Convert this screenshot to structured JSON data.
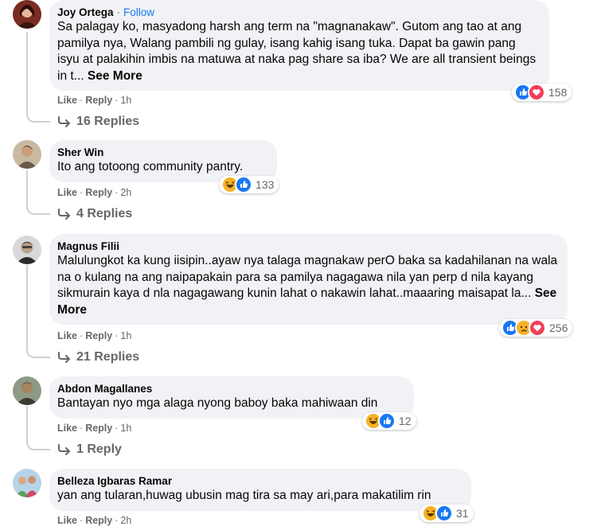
{
  "comments": [
    {
      "author": "Joy Ortega",
      "follow": "Follow",
      "text": "Sa palagay ko, masyadong harsh ang term na \"magnanakaw\". Gutom ang tao at ang pamilya nya, Walang pambili ng gulay, isang kahig isang tuka. Dapat ba gawin pang isyu at palakihin imbis na matuwa at naka pag share sa iba? We are all transient beings in t...",
      "see_more": "See More",
      "like": "Like",
      "reply": "Reply",
      "time": "1h",
      "reactions": [
        "like",
        "love"
      ],
      "reaction_count": "158",
      "replies_label": "16 Replies"
    },
    {
      "author": "Sher Win",
      "text": "Ito ang totoong community pantry.",
      "like": "Like",
      "reply": "Reply",
      "time": "2h",
      "reactions": [
        "haha",
        "like"
      ],
      "reaction_count": "133",
      "replies_label": "4 Replies"
    },
    {
      "author": "Magnus Filii",
      "text": "Malulungkot ka kung iisipin..ayaw nya talaga magnakaw perO baka sa kadahilanan na wala na o kulang na ang naipapakain para sa pamilya nagagawa nila yan perp d nila kayang sikmurain kaya d nla nagagawang kunin lahat o nakawin lahat..maaaring maisapat la...",
      "see_more": "See More",
      "like": "Like",
      "reply": "Reply",
      "time": "1h",
      "reactions": [
        "like",
        "sad",
        "love"
      ],
      "reaction_count": "256",
      "replies_label": "21 Replies"
    },
    {
      "author": "Abdon Magallanes",
      "text": "Bantayan nyo mga alaga nyong baboy baka mahiwaan din",
      "like": "Like",
      "reply": "Reply",
      "time": "1h",
      "reactions": [
        "haha",
        "like"
      ],
      "reaction_count": "12",
      "replies_label": "1 Reply"
    },
    {
      "author": "Belleza Igbaras Ramar",
      "text": "yan ang tularan,huwag ubusin mag tira sa may ari,para makatilim rin",
      "like": "Like",
      "reply": "Reply",
      "time": "2h",
      "reactions": [
        "haha",
        "like"
      ],
      "reaction_count": "31"
    }
  ],
  "colors": {
    "link_blue": "#1877f2",
    "bubble_bg": "#f0f2f5",
    "secondary_text": "#65676b",
    "like_blue": "#1877f2",
    "love_red": "#f33e58",
    "haha_yellow": "#f7b125"
  }
}
